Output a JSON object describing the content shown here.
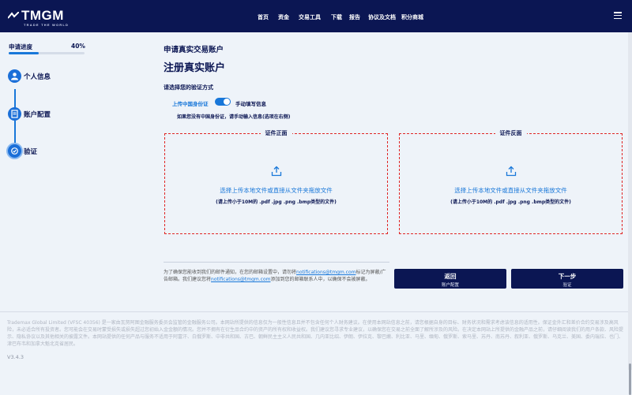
{
  "header": {
    "logo_text": "TMGM",
    "logo_tagline": "TRADE THE WORLD",
    "nav": [
      "首页",
      "资金",
      "交易工具",
      "下载",
      "报告",
      "协议及文档",
      "积分商城"
    ]
  },
  "sidebar": {
    "progress_label": "申请进度",
    "progress_value": "40%",
    "progress_fraction": 0.4,
    "steps": [
      {
        "label": "个人信息",
        "icon": "user-icon"
      },
      {
        "label": "账户配置",
        "icon": "document-icon"
      },
      {
        "label": "验证",
        "icon": "verify-icon"
      }
    ]
  },
  "main": {
    "subtitle": "申请真实交易账户",
    "title": "注册真实账户",
    "verify_label": "请选择您的验证方式",
    "option_left": "上传中国身份证",
    "option_right": "手动填写信息",
    "hint": "如果您没有中国身份证，请手动输入信息(选项在右侧)",
    "uploads": [
      {
        "caption": "证件正面",
        "text": "选择上传本地文件或直接从文件夹拖放文件",
        "note": "(请上传小于10M的 .pdf .jpg .png .bmp类型的文件)"
      },
      {
        "caption": "证件反面",
        "text": "选择上传本地文件或直接从文件夹拖放文件",
        "note": "(请上传小于10M的 .pdf .jpg .png .bmp类型的文件)"
      }
    ],
    "notice_a": "为了确保您能收到我们的邮件通知，在您的邮箱设置中，请勿将",
    "notice_email1": "notifications@tmgm.com",
    "notice_b": "标记为屏蔽/广告邮箱。我们建议您将",
    "notice_email2": "notifications@tmgm.com",
    "notice_c": "添加到您的邮箱联系人中，以确保不会被屏蔽。",
    "back_button": {
      "label": "返回",
      "sub": "账户配置"
    },
    "next_button": {
      "label": "下一步",
      "sub": "验证"
    }
  },
  "footer": {
    "text": "Trademax Global Limited (VFSC 40356) 是一家由瓦努阿图金融服务委员会监管的金融服务公司。本网站所提供的信息仅为一般性信息且并不包含任何个人财务建议。在使用本网站信息之前，请您根据自身的目标、财务状况和需求考虑该信息的适用性。保证金外汇和差价合约交易涉及高风险，未必适合所有投资者。您可能会在交易时蒙受损失或损失超过您初始入金金额的情况。您并不拥有在衍生品合约中的资产的所有权和收益权。我们建议您寻求专业建议，以确保您在交易之前全面了解所涉及的风险。在决定本网站上所提供的金融产品之前，请仔细阅读我们的用户条款、风险提示、隐私协议以及其他相关的披露文件。本网站提供的任何产品与服务不适用于阿富汗、白俄罗斯、中非共和国、古巴、朝鲜民主主义人民共和国、几内亚比绍、伊朗、伊拉克、黎巴嫩、利比亚、马里、缅甸、俄罗斯、索马里、苏丹、南苏丹、叙利亚、俄罗斯、乌克兰、美国、委内瑞拉、也门、津巴布韦和加拿大魁北克省居民。",
    "version": "V3.4.3"
  }
}
